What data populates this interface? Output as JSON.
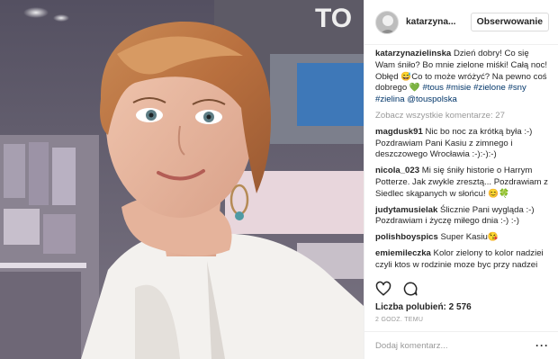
{
  "post": {
    "username": "katarzyna...",
    "follow_label": "Obserwowanie",
    "caption": {
      "user": "katarzynazielinska",
      "text": "Dzień dobry! Co się Wam śniło? Bo mnie zielone miśki! Całą noc! Obłęd 😅Co to może wróżyć? Na pewno coś dobrego 💚",
      "tags": [
        "#tous",
        "#misie",
        "#zielone",
        "#sny",
        "#zielina",
        "@touspolska"
      ]
    },
    "view_all": "Zobacz wszystkie komentarze: 27",
    "comments": [
      {
        "user": "magdusk91",
        "text": "Nic bo noc za krótką była :-) Pozdrawiam Pani Kasiu z zimnego i deszczowego Wrocławia :-):-):-)"
      },
      {
        "user": "nicola_023",
        "text": "Mi się śniły historie o Harrym Potterze. Jak zwykle zresztą... Pozdrawiam z Siedlec skąpanych w słońcu! 😊🍀"
      },
      {
        "user": "judytamusielak",
        "text": "Ślicznie Pani wygląda :-) Pozdrawiam i życzę miłego dnia :-) :-)"
      },
      {
        "user": "polishboyspics",
        "text": "Super Kasiu😘"
      },
      {
        "user": "emiemileczka",
        "text": "Kolor zielony to kolor nadziei czyli ktos w rodzinie moze byc przy nadzei czyli w ciazy u mnie sie"
      }
    ],
    "likes_text": "Liczba polubień: 2 576",
    "time_text": "2 GODZ. TEMU",
    "add_comment_placeholder": "Dodaj komentarz...",
    "more_icon_text": "···"
  },
  "icons": [
    "heart-icon",
    "comment-icon",
    "more-options-icon"
  ]
}
